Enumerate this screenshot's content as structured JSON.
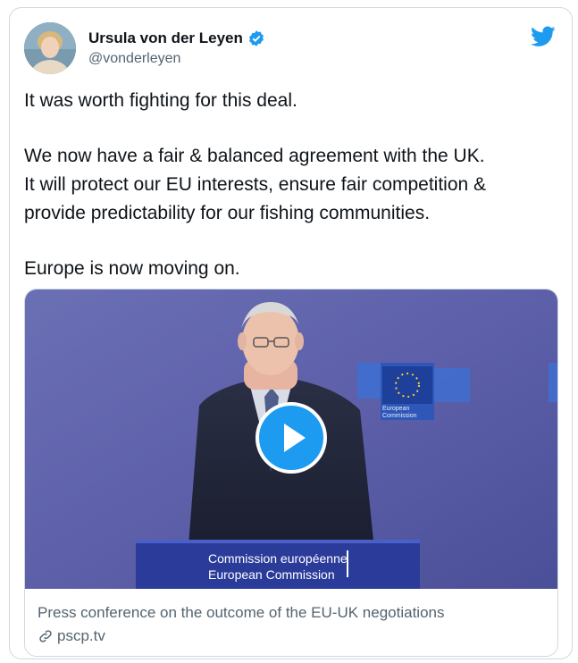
{
  "tweet": {
    "author_name": "Ursula von der Leyen",
    "author_handle": "@vonderleyen",
    "verified_icon": "verified-badge-icon",
    "brand_icon": "twitter-bird-icon",
    "brand_color": "#1d9bf0",
    "text_lines": [
      "It was worth fighting for this deal.",
      "We now have a fair & balanced agreement with the UK.",
      "It will protect our EU interests, ensure fair competition &",
      "provide predictability for our fishing communities.",
      "Europe is now moving on."
    ]
  },
  "media": {
    "podium_line_1": "Commission européenne",
    "podium_line_2": "European Commission",
    "backdrop_label_1": "European",
    "backdrop_label_2": "Commission",
    "caption": "Press conference on the outcome of the EU-UK negotiations",
    "link_text": "pscp.tv",
    "play_icon": "play-icon",
    "link_icon": "link-icon"
  }
}
